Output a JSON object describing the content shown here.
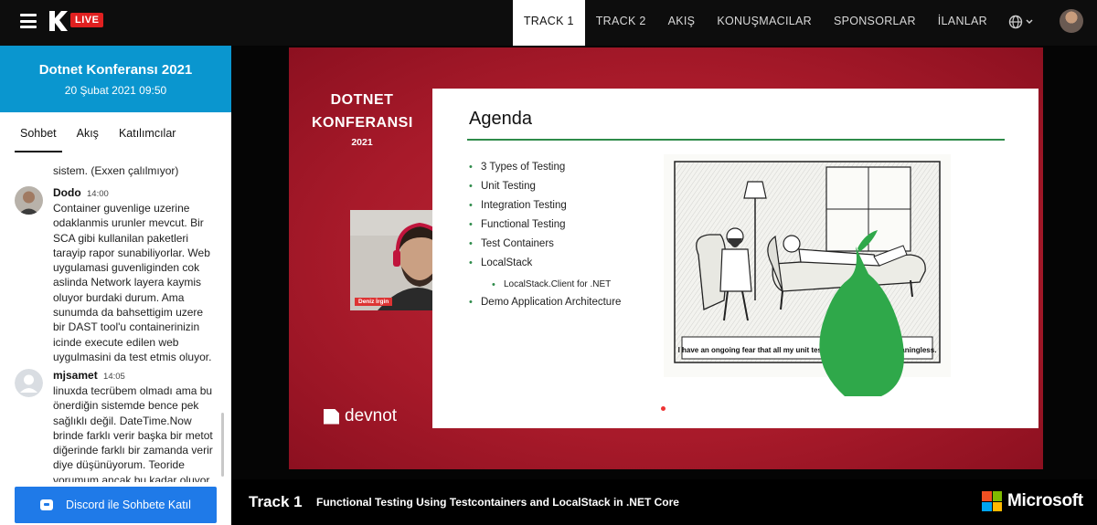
{
  "header": {
    "live_badge": "LIVE",
    "nav": [
      "TRACK 1",
      "TRACK 2",
      "AKIŞ",
      "KONUŞMACILAR",
      "SPONSORLAR",
      "İLANLAR"
    ]
  },
  "event": {
    "title": "Dotnet Konferansı 2021",
    "date": "20 Şubat 2021 09:50"
  },
  "sidebar_tabs": [
    "Sohbet",
    "Akış",
    "Katılımcılar"
  ],
  "chat": {
    "tail_text": "sistem. (Exxen çalılmıyor)",
    "messages": [
      {
        "user": "Dodo",
        "time": "14:00",
        "text": "Container guvenlige uzerine odaklanmis urunler mevcut. Bir SCA gibi kullanilan paketleri tarayip rapor sunabiliyorlar. Web uygulamasi guvenliginden cok aslinda Network layera kaymis oluyor burdaki durum. Ama sunumda da bahsettigim uzere bir DAST tool'u containerinizin icinde execute edilen web uygulmasini da test etmis oluyor."
      },
      {
        "user": "mjsamet",
        "time": "14:05",
        "text": "linuxda tecrübem olmadı ama bu önerdiğin sistemde bence pek sağlıklı değil. DateTime.Now brinde farklı verir başka bir metot diğerinde farklı bir zamanda verir diye düşünüyorum. Teoride yorumum ancak bu kadar oluyor"
      }
    ],
    "discord_button": "Discord ile Sohbete Katıl"
  },
  "slide": {
    "brand_line1": "DOTNET",
    "brand_line2": "KONFERANSI",
    "brand_year": "2021",
    "devnot": "devnot",
    "agenda_title": "Agenda",
    "agenda_items": [
      "3 Types of Testing",
      "Unit Testing",
      "Integration Testing",
      "Functional Testing",
      "Test Containers",
      "LocalStack",
      "LocalStack.Client for .NET",
      "Demo Application Architecture"
    ],
    "cartoon_caption": "I have an ongoing fear that all my unit tests pass, but they're meaningless.",
    "speaker_name": "Deniz İrgin"
  },
  "footer": {
    "track": "Track 1",
    "talk": "Functional Testing Using Testcontainers and LocalStack in .NET Core",
    "sponsor": "Microsoft"
  },
  "colors": {
    "accent_blue": "#0a96cf",
    "live_red": "#e02020",
    "discord_blue": "#1f7ae8",
    "slide_red": "#b01e2e",
    "agenda_green": "#2e8b4a"
  }
}
